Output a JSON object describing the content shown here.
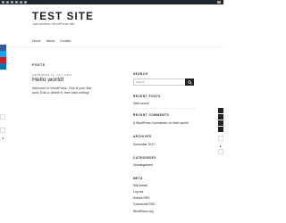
{
  "site": {
    "title": "TEST SITE",
    "description": "Just another WordPress site"
  },
  "nav": [
    "Home",
    "About",
    "Contact"
  ],
  "main": {
    "heading": "POSTS",
    "post": {
      "meta": "DECEMBER 12, 2017 EDIT",
      "title": "Hello world!",
      "body": "Welcome to WordPress. This is your first post. Edit or delete it, then start writing!"
    }
  },
  "sidebar": {
    "search_title": "SEARCH",
    "search_placeholder": "Search",
    "recent_posts_title": "RECENT POSTS",
    "recent_posts": [
      "Hello world!"
    ],
    "recent_comments_title": "RECENT COMMENTS",
    "recent_comments": [
      "A WordPress Commenter on Hello world!"
    ],
    "archives_title": "ARCHIVES",
    "archives": [
      "December 2017"
    ],
    "categories_title": "CATEGORIES",
    "categories": [
      "Uncategorized"
    ],
    "meta_title": "META",
    "meta": [
      "Site Admin",
      "Log out",
      "Entries RSS",
      "Comments RSS",
      "WordPress.org"
    ]
  },
  "share_colors": {
    "facebook": "#3b5998",
    "twitter": "#1da1f2",
    "pinterest": "#cb2027",
    "email": "#0077b5"
  }
}
